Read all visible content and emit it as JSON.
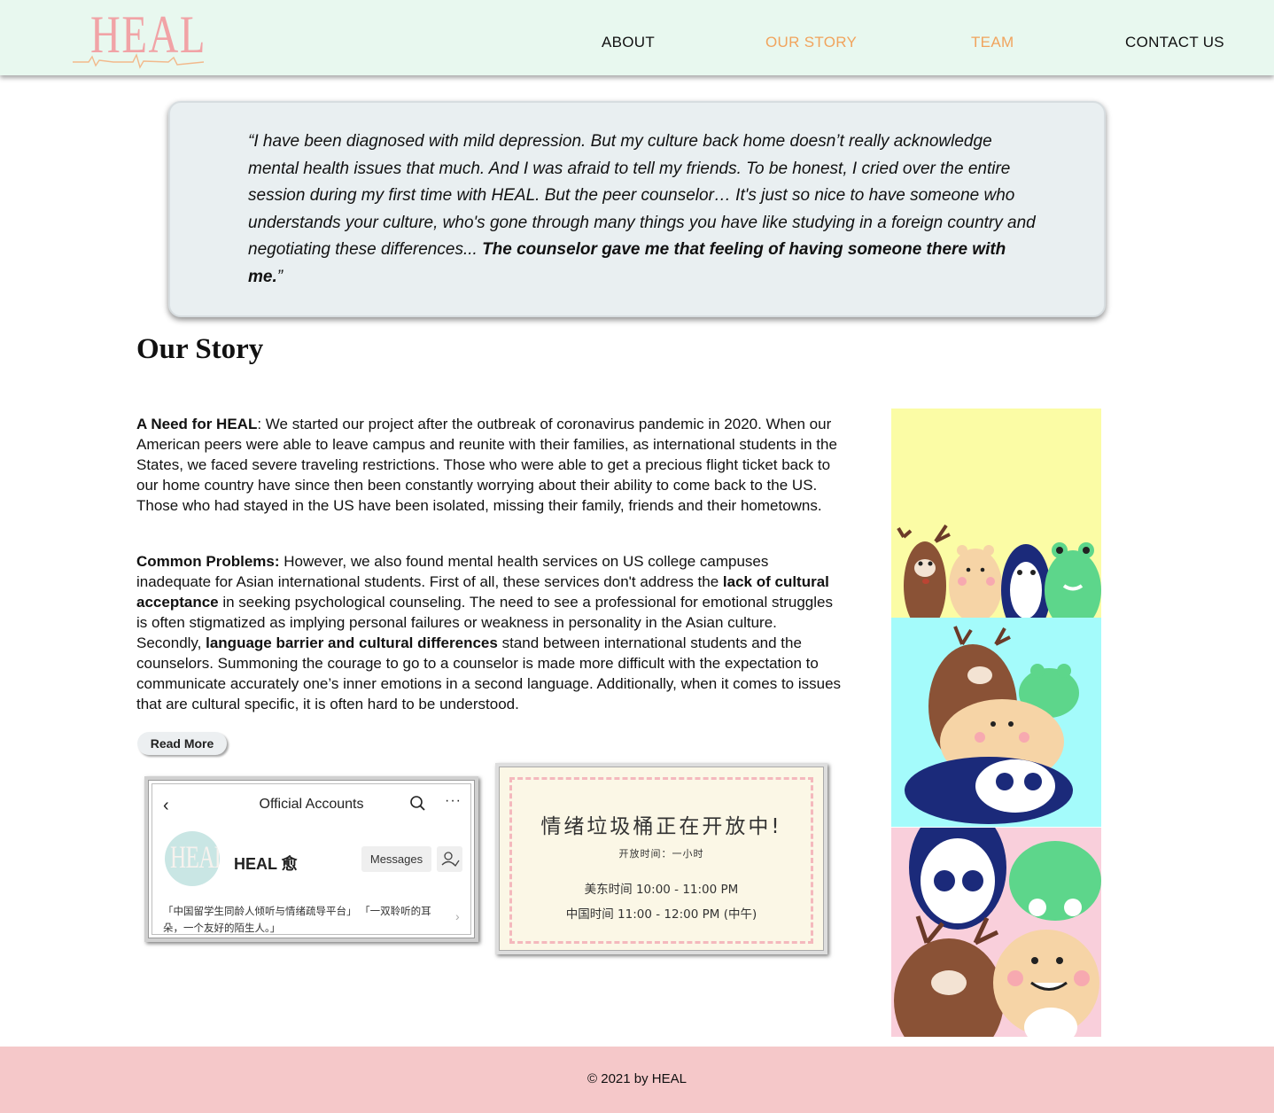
{
  "header": {
    "logo_text": "HEAL",
    "nav": {
      "about": "ABOUT",
      "our_story": "OUR STORY",
      "team": "TEAM",
      "contact": "CONTACT US"
    }
  },
  "quote": {
    "text_italic": "“I have been diagnosed with mild depression. But my culture back home doesn’t really acknowledge mental health issues that much. And I was afraid to tell my friends. To be honest, I cried over the entire session during my first time with HEAL. But the peer counselor… It's just so nice to have someone who understands your culture, who's gone through many things you have like studying in a foreign country and negotiating these differences... ",
    "text_bold": "The counselor gave me that feeling of having someone there with me.",
    "text_end": "”"
  },
  "story": {
    "title": "Our Story",
    "p1_lead": "A Need for HEAL",
    "p1_text": ": We started our project after the outbreak of coronavirus pandemic in 2020. When our American peers were able to leave campus and reunite with their families, as international students in the States, we faced severe traveling restrictions. Those who were able to get a precious flight ticket back to our home country have since then been constantly worrying about their ability to come back to the US. Those who had stayed in the US have been isolated, missing their family, friends and their hometowns.",
    "p2_lead": "Common Problems:",
    "p2_a": " However, we also found mental health services on US college campuses inadequate for Asian international students. First of all, these services don't address the ",
    "p2_b": "lack of cultural acceptance",
    "p2_c": " in seeking psychological counseling. The need to see a professional for emotional struggles is often stigmatized as implying personal failures or weakness in personality in the Asian culture. Secondly, ",
    "p2_d": "language barrier and cultural differences",
    "p2_e": " stand between international students and the counselors. Summoning the courage to go to a counselor is made more difficult with the expectation to communicate accurately one’s inner emotions in a second language. Additionally, when it comes to issues that are cultural specific, it is often hard to be understood.",
    "read_more": "Read More"
  },
  "official_account": {
    "title": "Official Accounts",
    "name": "HEAL 愈",
    "avatar_text": "HEAL",
    "messages_label": "Messages",
    "description": "「中国留学生同龄人倾听与情绪疏导平台」 「一双聆听的耳朵，一个友好的陌生人。」"
  },
  "notice": {
    "title": "情绪垃圾桶正在开放中!",
    "subtitle": "开放时间：一小时",
    "line1": "美东时间 10:00 - 11:00 PM",
    "line2": "中国时间 11:00 - 12:00 PM (中午)"
  },
  "colors": {
    "header_bg": "#e8f8ef",
    "nav_active": "#f1a45d",
    "quote_bg": "#e9eff1",
    "footer_bg": "#f5c8c9",
    "panel_yellow": "#fbfca5",
    "panel_cyan": "#a4fbfb",
    "panel_pink": "#f9cfdb"
  },
  "footer": {
    "copyright": "© 2021 by HEAL"
  }
}
